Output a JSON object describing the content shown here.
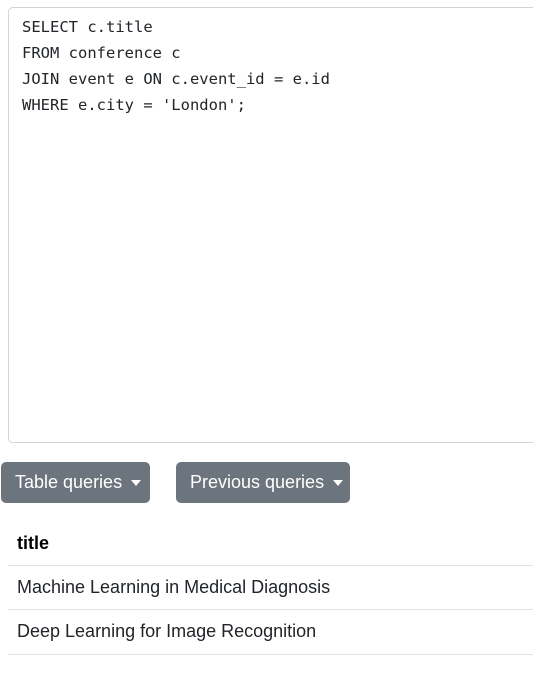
{
  "editor": {
    "lines": [
      "SELECT c.title",
      "FROM conference c",
      "JOIN event e ON c.event_id = e.id",
      "WHERE e.city = 'London';"
    ]
  },
  "buttons": {
    "table_queries": "Table queries",
    "previous_queries": "Previous queries"
  },
  "results": {
    "columns": [
      "title"
    ],
    "rows": [
      [
        "Machine Learning in Medical Diagnosis"
      ],
      [
        "Deep Learning for Image Recognition"
      ]
    ]
  },
  "colors": {
    "button_bg": "#6c757d",
    "border": "#dee2e6"
  }
}
